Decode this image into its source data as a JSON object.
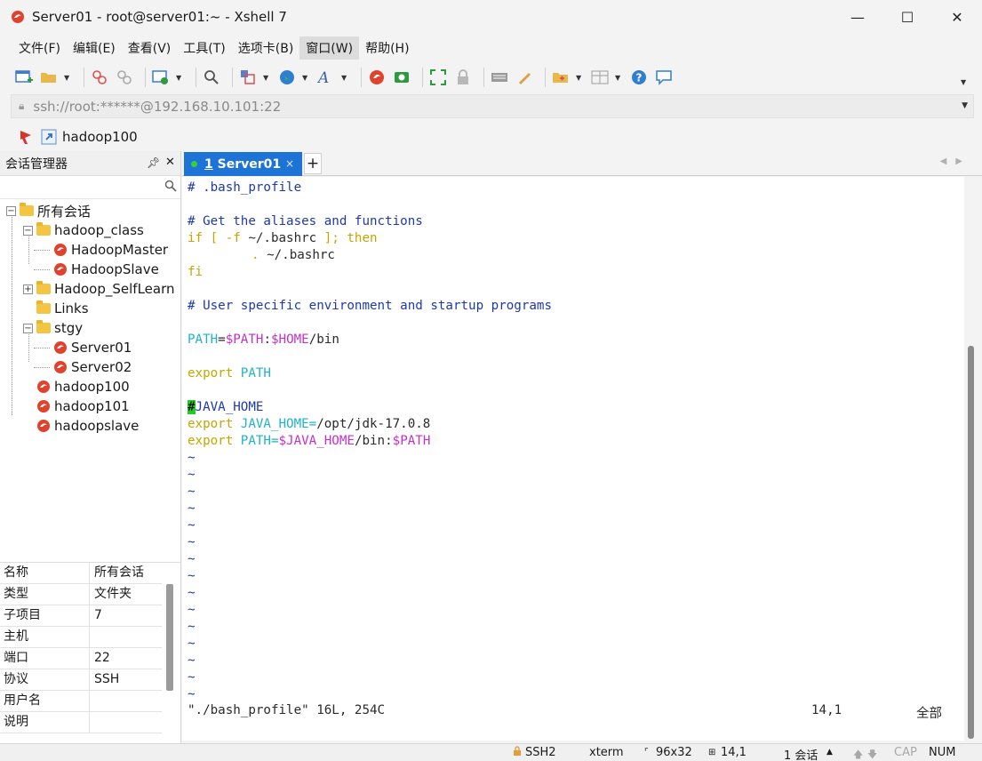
{
  "window": {
    "title": "Server01 - root@server01:~ - Xshell 7",
    "minimize_glyph": "—",
    "maximize_glyph": "☐",
    "close_glyph": "✕"
  },
  "menu": [
    "文件(F)",
    "编辑(E)",
    "查看(V)",
    "工具(T)",
    "选项卡(B)",
    "窗口(W)",
    "帮助(H)"
  ],
  "address": {
    "value": "ssh://root:******@192.168.10.101:22"
  },
  "links": {
    "link_label": "hadoop100"
  },
  "session_manager": {
    "title": "会话管理器",
    "search_placeholder": "",
    "tree": {
      "root": "所有会话",
      "hadoop_class": "hadoop_class",
      "hadoop_master": "HadoopMaster",
      "hadoop_slave": "HadoopSlave",
      "hadoop_selflearn": "Hadoop_SelfLearn",
      "links": "Links",
      "stgy": "stgy",
      "server01": "Server01",
      "server02": "Server02",
      "hadoop100": "hadoop100",
      "hadoop101": "hadoop101",
      "hadoopslave": "hadoopslave"
    },
    "properties": [
      {
        "key": "名称",
        "value": "所有会话"
      },
      {
        "key": "类型",
        "value": "文件夹"
      },
      {
        "key": "子项目",
        "value": "7"
      },
      {
        "key": "主机",
        "value": ""
      },
      {
        "key": "端口",
        "value": "22"
      },
      {
        "key": "协议",
        "value": "SSH"
      },
      {
        "key": "用户名",
        "value": ""
      },
      {
        "key": "说明",
        "value": ""
      }
    ]
  },
  "tabs": {
    "active_tab_number": "1",
    "active_tab_label": " Server01",
    "close_glyph": "×",
    "add_glyph": "+"
  },
  "terminal": {
    "lines": {
      "l1": "# .bash_profile",
      "l3": "# Get the aliases and functions",
      "l4_if": "if [ -f ",
      "l4_file": "~/.bashrc",
      "l4_end": " ]; then",
      "l5_dot": ".",
      "l5_file": " ~/.bashrc",
      "l6": "fi",
      "l8": "# User specific environment and startup programs",
      "l10_var": "PATH",
      "l10_eq": "=",
      "l10_path": "$PATH",
      "l10_colon": ":",
      "l10_home": "$HOME",
      "l10_bin": "/bin",
      "l12_export": "export",
      "l12_var": " PATH",
      "l14_cursor": "#",
      "l14_rest": "JAVA_HOME",
      "l15_export": "export",
      "l15_var": " JAVA_HOME",
      "l15_eq": "=",
      "l15_val": "/opt/jdk-17.0.8",
      "l16_export": "export",
      "l16_var": " PATH",
      "l16_eq": "=",
      "l16_jh": "$JAVA_HOME",
      "l16_bin": "/bin:",
      "l16_path": "$PATH",
      "tilde": "~"
    },
    "status_file": "\"./bash_profile\" 16L, 254C",
    "status_pos": "14,1",
    "status_all": "全部"
  },
  "statusbar": {
    "protocol": "SSH2",
    "term": "xterm",
    "size": "96x32",
    "cursor": "14,1",
    "sessions": "1 会话",
    "cap": "CAP",
    "num": "NUM"
  },
  "colors": {
    "tab_active": "#1e74d6",
    "comment": "#1f3aa8",
    "keyword": "#c5a500",
    "variable": "#1fb3c9",
    "dollar_var": "#c331c9",
    "cursor": "#22cc22"
  }
}
